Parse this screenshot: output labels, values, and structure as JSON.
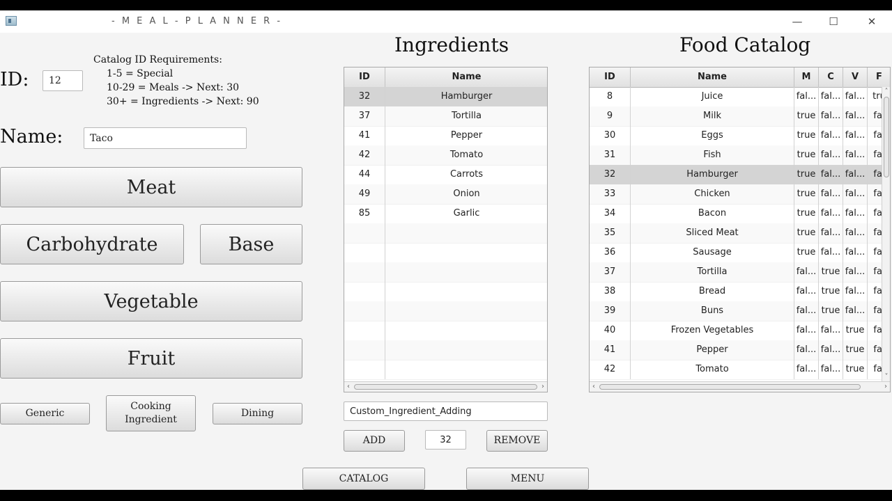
{
  "window": {
    "title": "- M E A L - P L A N N E R -",
    "minimize": "—",
    "maximize": "☐",
    "close": "✕"
  },
  "form": {
    "id_label": "ID:",
    "id_value": "12",
    "requirements": [
      "Catalog ID Requirements:",
      "1-5 = Special",
      "10-29 = Meals  ->  Next: 30",
      "30+ = Ingredients  ->  Next: 90"
    ],
    "name_label": "Name:",
    "name_value": "Taco"
  },
  "category_buttons": {
    "meat": "Meat",
    "carbohydrate": "Carbohydrate",
    "base": "Base",
    "vegetable": "Vegetable",
    "fruit": "Fruit"
  },
  "type_buttons": {
    "generic": "Generic",
    "cooking_line1": "Cooking",
    "cooking_line2": "Ingredient",
    "dining": "Dining"
  },
  "ingredients": {
    "title": "Ingredients",
    "columns": [
      "ID",
      "Name"
    ],
    "rows": [
      {
        "id": "32",
        "name": "Hamburger"
      },
      {
        "id": "37",
        "name": "Tortilla"
      },
      {
        "id": "41",
        "name": "Pepper"
      },
      {
        "id": "42",
        "name": "Tomato"
      },
      {
        "id": "44",
        "name": "Carrots"
      },
      {
        "id": "49",
        "name": "Onion"
      },
      {
        "id": "85",
        "name": "Garlic"
      }
    ],
    "selected_row": 0,
    "custom_input": "Custom_Ingredient_Adding",
    "add_label": "ADD",
    "id_field": "32",
    "remove_label": "REMOVE"
  },
  "catalog": {
    "title": "Food Catalog",
    "columns": [
      "ID",
      "Name",
      "M",
      "C",
      "V",
      "F"
    ],
    "rows": [
      {
        "id": "8",
        "name": "Juice",
        "m": "fal...",
        "c": "fal...",
        "v": "fal...",
        "f": "tru"
      },
      {
        "id": "9",
        "name": "Milk",
        "m": "true",
        "c": "fal...",
        "v": "fal...",
        "f": "fal"
      },
      {
        "id": "30",
        "name": "Eggs",
        "m": "true",
        "c": "fal...",
        "v": "fal...",
        "f": "fal"
      },
      {
        "id": "31",
        "name": "Fish",
        "m": "true",
        "c": "fal...",
        "v": "fal...",
        "f": "fal"
      },
      {
        "id": "32",
        "name": "Hamburger",
        "m": "true",
        "c": "fal...",
        "v": "fal...",
        "f": "fal"
      },
      {
        "id": "33",
        "name": "Chicken",
        "m": "true",
        "c": "fal...",
        "v": "fal...",
        "f": "fal"
      },
      {
        "id": "34",
        "name": "Bacon",
        "m": "true",
        "c": "fal...",
        "v": "fal...",
        "f": "fal"
      },
      {
        "id": "35",
        "name": "Sliced Meat",
        "m": "true",
        "c": "fal...",
        "v": "fal...",
        "f": "fal"
      },
      {
        "id": "36",
        "name": "Sausage",
        "m": "true",
        "c": "fal...",
        "v": "fal...",
        "f": "fal"
      },
      {
        "id": "37",
        "name": "Tortilla",
        "m": "fal...",
        "c": "true",
        "v": "fal...",
        "f": "fal"
      },
      {
        "id": "38",
        "name": "Bread",
        "m": "fal...",
        "c": "true",
        "v": "fal...",
        "f": "fal"
      },
      {
        "id": "39",
        "name": "Buns",
        "m": "fal...",
        "c": "true",
        "v": "fal...",
        "f": "fal"
      },
      {
        "id": "40",
        "name": "Frozen Vegetables",
        "m": "fal...",
        "c": "fal...",
        "v": "true",
        "f": "fal"
      },
      {
        "id": "41",
        "name": "Pepper",
        "m": "fal...",
        "c": "fal...",
        "v": "true",
        "f": "fal"
      },
      {
        "id": "42",
        "name": "Tomato",
        "m": "fal...",
        "c": "fal...",
        "v": "true",
        "f": "fal"
      }
    ],
    "selected_row": 4
  },
  "bottom": {
    "catalog_label": "CATALOG",
    "menu_label": "MENU"
  }
}
